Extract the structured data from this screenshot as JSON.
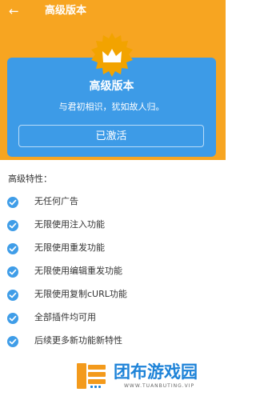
{
  "header": {
    "back_icon": "arrow-left-icon",
    "title": "高级版本"
  },
  "banner": {
    "badge_icon": "crown-badge-icon",
    "card": {
      "title": "高级版本",
      "subtitle": "与君初相识，犹如故人归。",
      "button_label": "已激活"
    }
  },
  "features": {
    "title": "高级特性：",
    "items": [
      {
        "icon": "check-circle-icon",
        "label": "无任何广告"
      },
      {
        "icon": "check-circle-icon",
        "label": "无限使用注入功能"
      },
      {
        "icon": "check-circle-icon",
        "label": "无限使用重发功能"
      },
      {
        "icon": "check-circle-icon",
        "label": "无限使用编辑重发功能"
      },
      {
        "icon": "check-circle-icon",
        "label": "无限使用复制cURL功能"
      },
      {
        "icon": "check-circle-icon",
        "label": "全部插件均可用"
      },
      {
        "icon": "check-circle-icon",
        "label": "后续更多新功能新特性"
      }
    ]
  },
  "watermark": {
    "brand": "团布游戏园",
    "site": "WWW.TUANBUTING.VIP"
  },
  "colors": {
    "accent": "#f7a521",
    "card": "#3d9be7",
    "check": "#3f9de8"
  }
}
